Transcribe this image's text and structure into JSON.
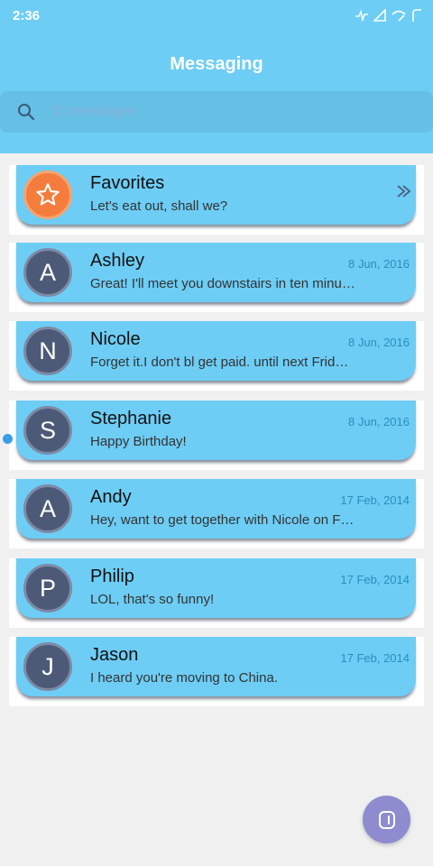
{
  "status_bar": {
    "time": "2:36",
    "icons": [
      "activity-icon",
      "signal-icon",
      "wifi-icon",
      "battery-icon"
    ]
  },
  "header": {
    "title": "Messaging"
  },
  "search": {
    "placeholder": "11 messages",
    "icon": "search-icon"
  },
  "conversations": [
    {
      "name": "Favorites",
      "date": "",
      "snippet": "Let's eat out, shall we?",
      "initial": "",
      "favorite": true,
      "unread": false
    },
    {
      "name": "Ashley",
      "date": "8 Jun, 2016",
      "snippet": "Great! I'll meet you downstairs in ten minu…",
      "initial": "A",
      "favorite": false,
      "unread": false
    },
    {
      "name": "Nicole",
      "date": "8 Jun, 2016",
      "snippet": "Forget it.I don't bl get paid. until next Frid…",
      "initial": "N",
      "favorite": false,
      "unread": false
    },
    {
      "name": "Stephanie",
      "date": "8 Jun, 2016",
      "snippet": "Happy Birthday!",
      "initial": "S",
      "favorite": false,
      "unread": true
    },
    {
      "name": "Andy",
      "date": "17 Feb, 2014",
      "snippet": "Hey, want to get together with Nicole on F…",
      "initial": "A",
      "favorite": false,
      "unread": false
    },
    {
      "name": "Philip",
      "date": "17 Feb, 2014",
      "snippet": "LOL, that's so funny!",
      "initial": "P",
      "favorite": false,
      "unread": false
    },
    {
      "name": "Jason",
      "date": "17 Feb, 2014",
      "snippet": "I heard you're moving to China.",
      "initial": "J",
      "favorite": false,
      "unread": false
    }
  ],
  "fab": {
    "icon": "compose-icon"
  },
  "colors": {
    "header": "#6dcdf5",
    "card": "#6dcdf5",
    "avatar": "#4c5a78",
    "favorite_avatar": "#f47c3c",
    "date": "#2a8fbd",
    "unread_dot": "#3a9ee6",
    "fab": "#8e8ccf"
  }
}
